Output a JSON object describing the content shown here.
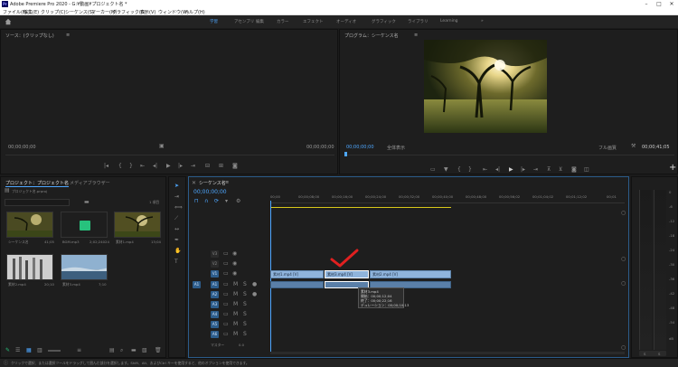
{
  "app": {
    "title": "Adobe Premiere Pro 2020 - G:¥動画¥プロジェクト名 *",
    "icon_label": "Pr"
  },
  "menu": [
    "ファイル(F)",
    "編集(E)",
    "クリップ(C)",
    "シーケンス(S)",
    "マーカー(M)",
    "グラフィック(G)",
    "表示(V)",
    "ウィンドウ(W)",
    "ヘルプ(H)"
  ],
  "workspaces": {
    "items": [
      "学習",
      "アセンブリ",
      "編集",
      "カラー",
      "エフェクト",
      "オーディオ",
      "グラフィック",
      "ライブラリ",
      "Learning"
    ],
    "active_index": 0,
    "more": "»"
  },
  "source_monitor": {
    "title": "ソース：(クリップなし)",
    "menu_icon": "≡",
    "timecode_left": "00;00;00;00",
    "timecode_right": "00;00;00;00"
  },
  "program_monitor": {
    "title": "プログラム：シーケンス名",
    "menu_icon": "≡",
    "timecode": "00;00;00;00",
    "fit": "全体表示",
    "quality": "フル画質",
    "duration": "00;00;41;05"
  },
  "project_panel": {
    "tab_active": "プロジェクト：プロジェクト名",
    "tab_other": "メディアブラウザー",
    "file": "プロジェクト名.prproj",
    "count": "1 項目",
    "items": [
      {
        "name": "シーケンス名",
        "duration": "41;05"
      },
      {
        "name": "BGM.mp3",
        "duration": "2;02;24024"
      },
      {
        "name": "素材1.mp4",
        "duration": "13;04"
      },
      {
        "name": "素材2.mp4",
        "duration": "20;10"
      },
      {
        "name": "素材3.mp4",
        "duration": "7;10"
      }
    ]
  },
  "timeline": {
    "tab": "シーケンス名",
    "menu_icon": "≡",
    "timecode": "00;00;00;00",
    "ruler": [
      "00;00",
      "00;00;08;00",
      "00;00;16;00",
      "00;00;24;00",
      "00;00;32;00",
      "00;00;40;00",
      "00;00;48;00",
      "00;00;56;02",
      "00;01;04;02",
      "00;01;12;02",
      "00;01"
    ],
    "video_tracks": [
      "V3",
      "V2",
      "V1"
    ],
    "audio_tracks": [
      "A1",
      "A2",
      "A3",
      "A4",
      "A5",
      "A6"
    ],
    "source_patch_v": "V1",
    "source_patch_a": "A1",
    "master_label": "マスター",
    "master_value": "0.0",
    "clips": [
      {
        "label": "素材1.mp4 [V]"
      },
      {
        "label": "素材3.mp4 [V]"
      },
      {
        "label": "素材2.mp4 [V]"
      }
    ],
    "tooltip": {
      "name": "素材3.mp4",
      "start": "開始：00;00;12;04",
      "end": "終了：00;00;22;16",
      "duration": "デュレーション：00;00;10;13"
    }
  },
  "status_bar": {
    "text": "クリックで選択、または選択ツールをドラッグして囲んだ部分を選択します。Shift、Alt、およびCtrl キーを使用すると、他のオプションを使用できます。"
  },
  "meters": {
    "scale": [
      "0",
      "-6",
      "-12",
      "-18",
      "-24",
      "-30",
      "-36",
      "-42",
      "-48",
      "-54",
      "dB"
    ],
    "solo": "S"
  },
  "colors": {
    "accent": "#4ea7ff",
    "clip_video": "#8fb4dc",
    "clip_audio": "#5a7fa8",
    "checkmark": "#e02020",
    "playhead_bar": "#d8c81a"
  }
}
